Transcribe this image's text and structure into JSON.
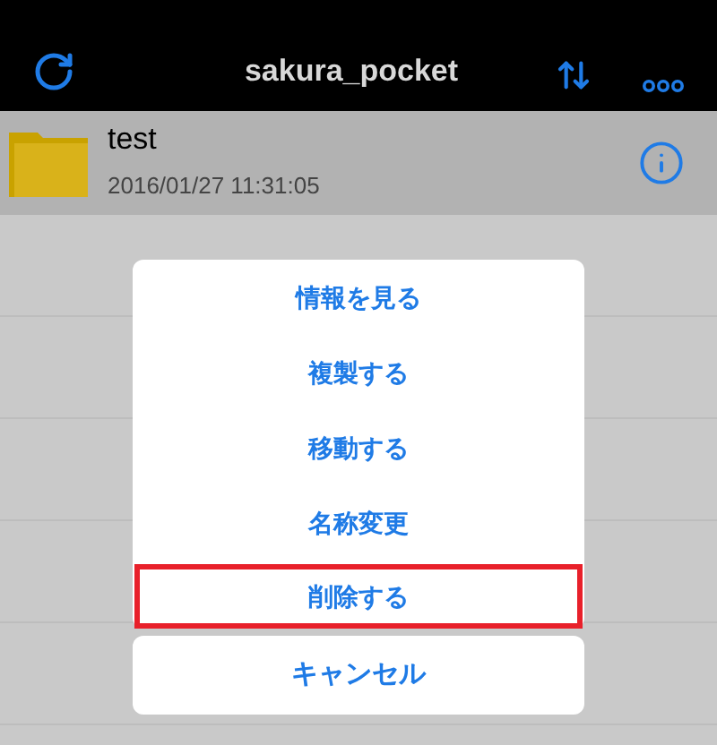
{
  "nav_bar": {
    "title": "sakura_pocket"
  },
  "files": [
    {
      "name": "test",
      "modified": "2016/01/27 11:31:05"
    }
  ],
  "action_sheet": {
    "items": [
      {
        "label": "情報を見る",
        "highlighted": false
      },
      {
        "label": "複製する",
        "highlighted": false
      },
      {
        "label": "移動する",
        "highlighted": false
      },
      {
        "label": "名称変更",
        "highlighted": false
      },
      {
        "label": "削除する",
        "highlighted": true
      }
    ],
    "cancel": "キャンセル"
  }
}
